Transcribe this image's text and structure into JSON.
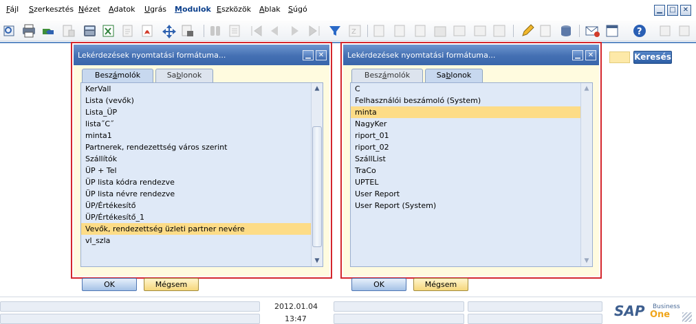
{
  "menu": {
    "items": [
      {
        "pre": "",
        "key": "F",
        "post": "ájl"
      },
      {
        "pre": "",
        "key": "S",
        "post": "zerkesztés"
      },
      {
        "pre": "",
        "key": "N",
        "post": "ézet"
      },
      {
        "pre": "",
        "key": "A",
        "post": "datok"
      },
      {
        "pre": "",
        "key": "U",
        "post": "grás"
      },
      {
        "pre": "",
        "key": "M",
        "post": "odulok"
      },
      {
        "pre": "",
        "key": "E",
        "post": "szközök"
      },
      {
        "pre": "",
        "key": "A",
        "post": "blak"
      },
      {
        "pre": "",
        "key": "S",
        "post": "úgó"
      }
    ],
    "window_controls": [
      "minimize-icon",
      "restore-icon",
      "close-icon"
    ]
  },
  "toolbar": {
    "icons": [
      "preview-icon",
      "print-icon",
      "export-icon",
      "doc-icon",
      "calc-icon",
      "excel-icon",
      "file-icon",
      "pdf-icon",
      "move-icon",
      "lock-icon",
      "binoculars-icon",
      "list-icon",
      "first-icon",
      "prev-icon",
      "next-icon",
      "last-icon",
      "filter-icon",
      "sort-icon",
      "base-doc-icon",
      "target-doc-icon",
      "report-icon",
      "stack-icon",
      "book-icon",
      "journal-icon",
      "find-icon",
      "edit-icon",
      "settings-icon",
      "database-icon",
      "mail-icon",
      "calendar-icon",
      "help-icon",
      "ext1-icon",
      "ext2-icon"
    ],
    "colors": {
      "accent": "#2f62b0",
      "pdf": "#d23b2a",
      "filter": "#2a69c7",
      "help": "#2a5fb4"
    }
  },
  "background": {
    "search_button_label": "Keresés"
  },
  "dialogs": [
    {
      "title": "Lekérdezések nyomtatási formátuma...",
      "tabs": [
        {
          "pre": "Besz",
          "key": "á",
          "post": "molók",
          "active": true
        },
        {
          "pre": "Sa",
          "key": "b",
          "post": "lonok",
          "active": false
        }
      ],
      "items": [
        "KerVall",
        "Lista (vevők)",
        "Lista_ÜP",
        "lista˝C˝",
        "minta1",
        "Partnerek, rendezettség város szerint",
        "Szállítók",
        "ÜP + Tel",
        "ÜP lista kódra rendezve",
        "ÜP lista névre rendezve",
        "ÜP/Értékesítő",
        "ÜP/Értékesítő_1",
        "Vevők, rendezettség üzleti partner nevére",
        "vl_szla"
      ],
      "selected_index": 12,
      "scroll": {
        "thumb_start": 0.2,
        "thumb_size": 0.75
      },
      "ok_label": "OK",
      "cancel_label": "Mégsem"
    },
    {
      "title": "Lekérdezések nyomtatási formátuma...",
      "tabs": [
        {
          "pre": "Besz",
          "key": "á",
          "post": "molók",
          "active": false
        },
        {
          "pre": "Sa",
          "key": "b",
          "post": "lonok",
          "active": true
        }
      ],
      "items": [
        "C",
        "Felhasználói beszámoló (System)",
        "minta",
        "NagyKer",
        "riport_01",
        "riport_02",
        "SzállList",
        "TraCo",
        "UPTEL",
        "User Report",
        "User Report (System)"
      ],
      "selected_index": 2,
      "scroll": null,
      "ok_label": "OK",
      "cancel_label": "Mégsem"
    }
  ],
  "status": {
    "date": "2012.01.04",
    "time": "13:47"
  },
  "logo": {
    "sap": "SAP",
    "business": "Business",
    "one": "One"
  }
}
